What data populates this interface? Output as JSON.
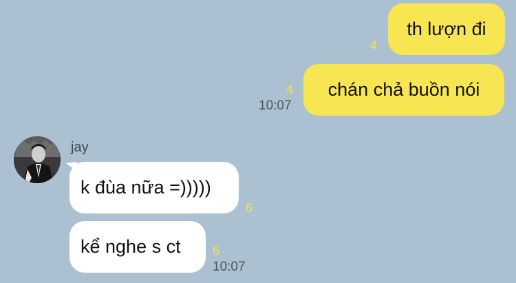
{
  "messages_out": [
    {
      "text": "th lượn đi",
      "count": "4"
    },
    {
      "text": "chán chả buồn nói",
      "count": "4",
      "time": "10:07"
    }
  ],
  "sender": {
    "name": "jay",
    "avatar_icon": "profile-photo"
  },
  "messages_in": [
    {
      "text": "k đùa nữa =)))))",
      "count": "6"
    },
    {
      "text": "kể nghe s ct",
      "count": "6",
      "time": "10:07"
    }
  ],
  "colors": {
    "background": "#abc0d0",
    "outgoing_bubble": "#f8e552",
    "incoming_bubble": "#ffffff",
    "unread_count": "#f2e34a"
  }
}
